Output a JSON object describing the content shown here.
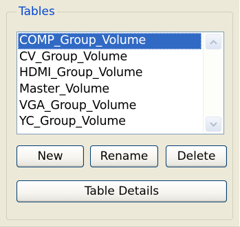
{
  "tables_group": {
    "title": "Tables",
    "list_items": [
      "COMP_Group_Volume",
      "CV_Group_Volume",
      "HDMI_Group_Volume",
      "Master_Volume",
      "VGA_Group_Volume",
      "YC_Group_Volume"
    ],
    "selected_item": "COMP_Group_Volume",
    "buttons": {
      "new_label": "New",
      "rename_label": "Rename",
      "delete_label": "Delete",
      "table_details_label": "Table Details"
    }
  },
  "icons": {
    "scroll_up": "chevron-up-icon",
    "scroll_down": "chevron-down-icon"
  },
  "colors": {
    "window_background": "#ece9d8",
    "group_title": "#0046d5",
    "selection_background": "#316ac5",
    "selection_text": "#ffffff",
    "button_border": "#003c74",
    "listbox_border": "#7f9db9"
  }
}
